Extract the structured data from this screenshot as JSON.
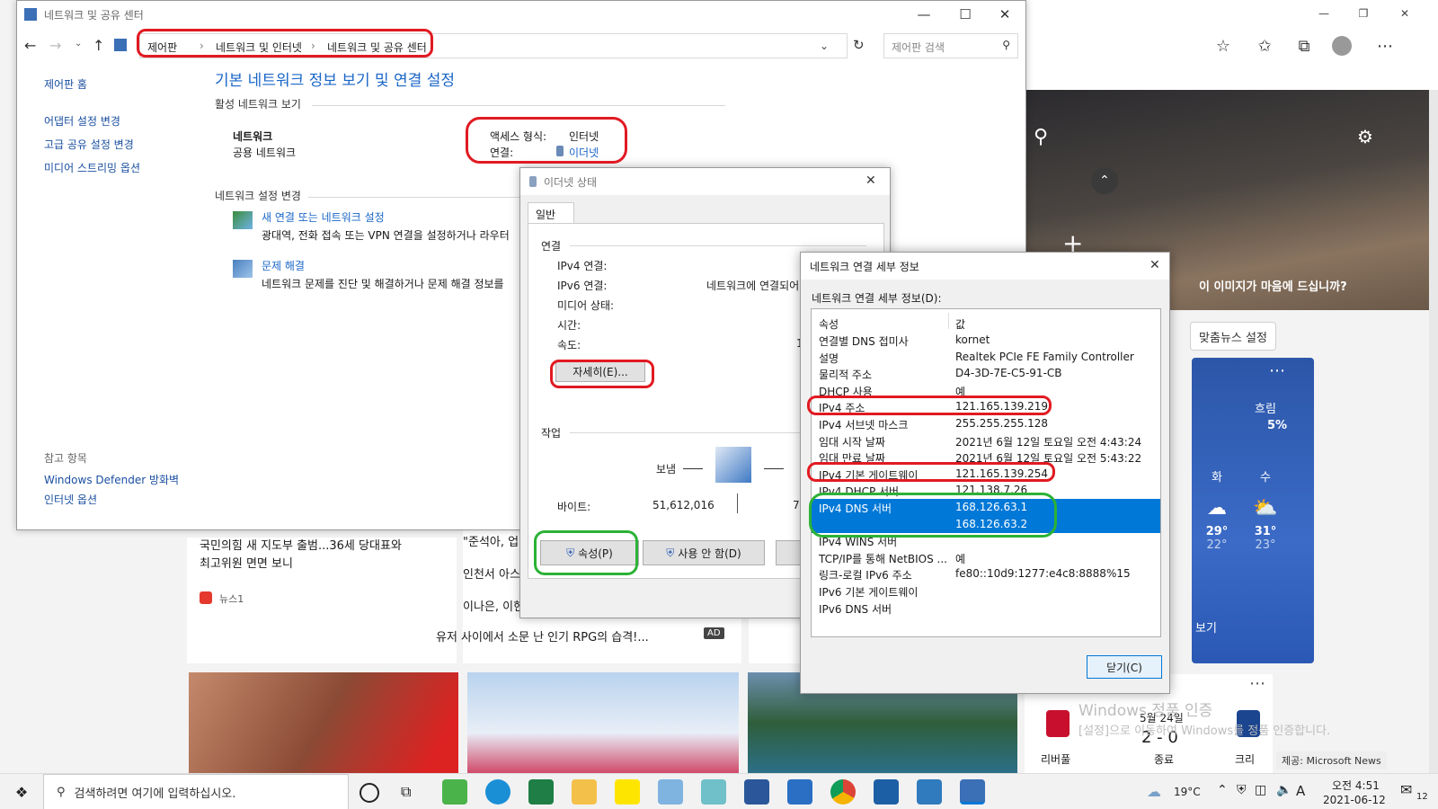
{
  "edge": {
    "hero_question": "이 이미지가 마음에 드십니까?",
    "news_setting": "맞춤뉴스 설정",
    "weather": {
      "condition": "흐림",
      "precip": "5%",
      "days": [
        {
          "label": "화",
          "hi": "29°",
          "lo": "22°"
        },
        {
          "label": "수",
          "hi": "31°",
          "lo": "23°"
        }
      ],
      "more": "보기"
    },
    "news_left": {
      "title": "국민의힘 새 지도부 출범...36세 당대표와 최고위원 면면 보니",
      "source": "뉴스1"
    },
    "news_mid": [
      "\"준석아, 업어줄게",
      "인천서 아스트라",
      "이나은, 이현주 왕",
      "유저 사이에서 소문 난 인기 RPG의 습격!..."
    ],
    "ad_label": "AD",
    "sports": {
      "date": "5월 24일",
      "score": "2 - 0",
      "status": "종료",
      "team_left": "리버풀",
      "team_right": "크리"
    },
    "provider": "제공: Microsoft News",
    "activation_title": "Windows 정품 인증",
    "activation_text": "[설정]으로 이동하여 Windows를 정품 인증합니다."
  },
  "control_panel": {
    "window_title": "네트워크 및 공유 센터",
    "breadcrumb": [
      "제어판",
      "네트워크 및 인터넷",
      "네트워크 및 공유 센터"
    ],
    "search_placeholder": "제어판 검색",
    "left_links": [
      "제어판 홈",
      "어댑터 설정 변경",
      "고급 공유 설정 변경",
      "미디어 스트리밍 옵션"
    ],
    "see_also": "참고 항목",
    "see_also_links": [
      "Windows Defender 방화벽",
      "인터넷 옵션"
    ],
    "heading": "기본 네트워크 정보 보기 및 연결 설정",
    "active_networks": "활성 네트워크 보기",
    "network_name": "네트워크",
    "network_type": "공용 네트워크",
    "access_label": "액세스 형식:",
    "access_value": "인터넷",
    "conn_label": "연결:",
    "conn_value": "이더넷",
    "change_settings": "네트워크 설정 변경",
    "tasks": [
      {
        "title": "새 연결 또는 네트워크 설정",
        "desc": "광대역, 전화 접속 또는 VPN 연결을 설정하거나 라우터"
      },
      {
        "title": "문제 해결",
        "desc": "네트워크 문제를 진단 및 해결하거나 문제 해결 정보를"
      }
    ]
  },
  "ethernet": {
    "title": "이더넷 상태",
    "tab": "일반",
    "section_connection": "연결",
    "rows": [
      {
        "label": "IPv4 연결:",
        "value": ""
      },
      {
        "label": "IPv6 연결:",
        "value": "네트워크에 연결되어"
      },
      {
        "label": "미디어 상태:",
        "value": ""
      },
      {
        "label": "시간:",
        "value": ""
      },
      {
        "label": "속도:",
        "value": "1"
      }
    ],
    "details_button": "자세히(E)...",
    "section_activity": "작업",
    "sent_label": "보냄",
    "bytes_label": "바이트:",
    "bytes_sent": "51,612,016",
    "bytes_recv": "7",
    "properties_button": "속성(P)",
    "disable_button": "사용 안 함(D)"
  },
  "details": {
    "title": "네트워크 연결 세부 정보",
    "label": "네트워크 연결 세부 정보(D):",
    "col_prop": "속성",
    "col_val": "값",
    "rows": [
      {
        "k": "연결별 DNS 접미사",
        "v": "kornet"
      },
      {
        "k": "설명",
        "v": "Realtek PCIe FE Family Controller"
      },
      {
        "k": "물리적 주소",
        "v": "D4-3D-7E-C5-91-CB"
      },
      {
        "k": "DHCP 사용",
        "v": "예"
      },
      {
        "k": "IPv4 주소",
        "v": "121.165.139.219"
      },
      {
        "k": "IPv4 서브넷 마스크",
        "v": "255.255.255.128"
      },
      {
        "k": "임대 시작 날짜",
        "v": "2021년 6월 12일 토요일 오전 4:43:24"
      },
      {
        "k": "임대 만료 날짜",
        "v": "2021년 6월 12일 토요일 오전 5:43:22"
      },
      {
        "k": "IPv4 기본 게이트웨이",
        "v": "121.165.139.254"
      },
      {
        "k": "IPv4 DHCP 서버",
        "v": "121.138.7.26"
      },
      {
        "k": "IPv4 DNS 서버",
        "v": "168.126.63.1"
      },
      {
        "k": "",
        "v": "168.126.63.2"
      },
      {
        "k": "IPv4 WINS 서버",
        "v": ""
      },
      {
        "k": "TCP/IP를 통해 NetBIOS ...",
        "v": "예"
      },
      {
        "k": "링크-로컬 IPv6 주소",
        "v": "fe80::10d9:1277:e4c8:8888%15"
      },
      {
        "k": "IPv6 기본 게이트웨이",
        "v": ""
      },
      {
        "k": "IPv6 DNS 서버",
        "v": ""
      }
    ],
    "close_button": "닫기(C)"
  },
  "taskbar": {
    "search_placeholder": "검색하려면 여기에 입력하십시오.",
    "temperature": "19°C",
    "ime": "A",
    "time": "오전 4:51",
    "date": "2021-06-12",
    "notif_count": "12"
  }
}
